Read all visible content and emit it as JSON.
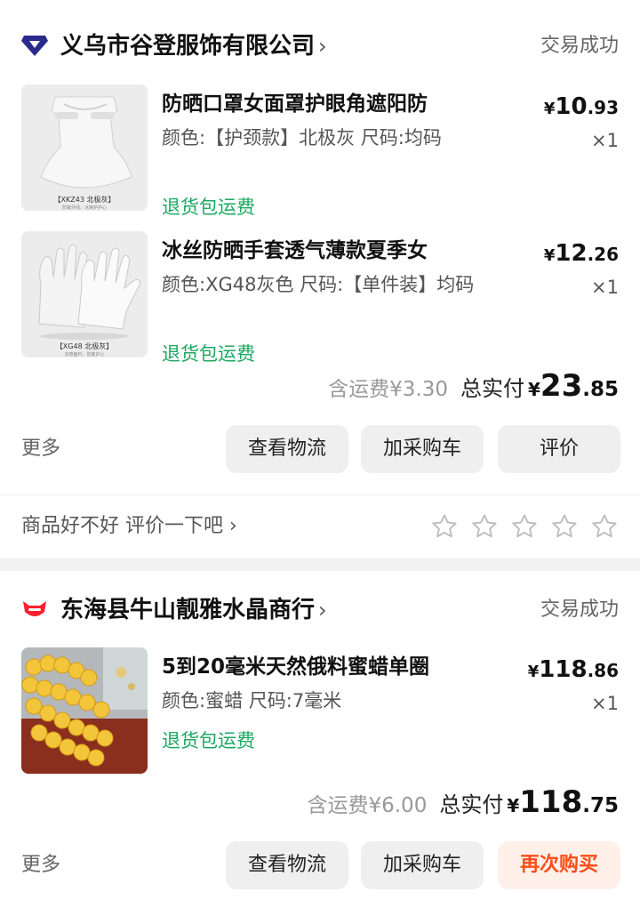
{
  "orders": [
    {
      "shop_name": "义乌市谷登服饰有限公司",
      "shop_icon": "tmall-diamond-icon",
      "status": "交易成功",
      "items": [
        {
          "title": "防晒口罩女面罩护眼角遮阳防",
          "spec": "颜色:【护颈款】北极灰 尺码:均码",
          "tag": "退货包运费",
          "price_yen": "¥",
          "price_int": "10",
          "price_dec": ".93",
          "qty": "×1",
          "thumb_caption": "【XKZ43 北极灰】",
          "thumb_sub": "防紫外线，冰爽护护心"
        },
        {
          "title": "冰丝防晒手套透气薄款夏季女",
          "spec": "颜色:XG48灰色 尺码:【单件装】均码",
          "tag": "退货包运费",
          "price_yen": "¥",
          "price_int": "12",
          "price_dec": ".26",
          "qty": "×1",
          "thumb_caption": "【XG48 北极灰】",
          "thumb_sub": "凉感面料，防紫护心"
        }
      ],
      "shipping": "含运费¥3.30",
      "total_label": "总实付",
      "total_yen": "¥",
      "total_int": "23",
      "total_dec": ".85",
      "more": "更多",
      "buttons": [
        "查看物流",
        "加采购车",
        "评价"
      ],
      "review_prompt": "商品好不好 评价一下吧 ›",
      "stars": 0
    },
    {
      "shop_name": "东海县牛山靓雅水晶商行",
      "shop_icon": "tmall-cat-icon",
      "status": "交易成功",
      "items": [
        {
          "title": "5到20毫米天然俄料蜜蜡单圈",
          "spec": "颜色:蜜蜡 尺码:7毫米",
          "tag": "退货包运费",
          "price_yen": "¥",
          "price_int": "118",
          "price_dec": ".86",
          "qty": "×1"
        }
      ],
      "shipping": "含运费¥6.00",
      "total_label": "总实付",
      "total_yen": "¥",
      "total_int": "118",
      "total_dec": ".75",
      "more": "更多",
      "buttons": [
        "查看物流",
        "加采购车",
        "再次购买"
      ]
    }
  ],
  "colors": {
    "accent_green": "#1ca862",
    "buy_again_text": "#ff4d18",
    "buy_again_bg": "#fff0ea",
    "shop1_icon": "#2a2a8c",
    "shop2_icon": "#ff1f2f"
  }
}
